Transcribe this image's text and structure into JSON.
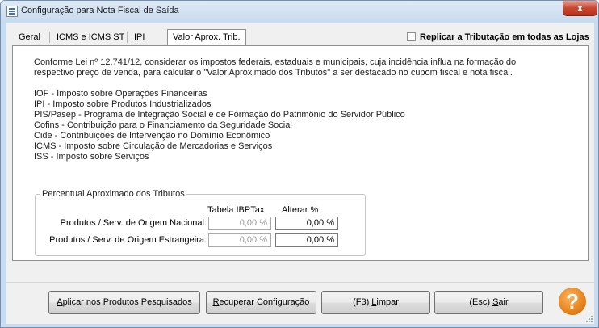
{
  "window": {
    "title": "Configuração para Nota Fiscal de Saída",
    "close_label": "x"
  },
  "tabs": [
    {
      "label": "Geral",
      "active": false
    },
    {
      "label": "ICMS e ICMS ST",
      "active": false
    },
    {
      "label": "IPI",
      "active": false
    },
    {
      "label": "Valor Aprox. Trib.",
      "active": true
    }
  ],
  "replicar": {
    "label": "Replicar a Tributação em todas as Lojas",
    "checked": false
  },
  "panel": {
    "intro_line1": "Conforme Lei nº 12.741/12, considerar os impostos federais, estaduais e municipais, cuja incidência influa na formação do",
    "intro_line2": "respectivo preço de venda, para calcular o \"Valor Aproximado dos Tributos\" a ser destacado no cupom fiscal e nota fiscal.",
    "taxes": [
      "IOF - Imposto sobre Operações Financeiras",
      "IPI - Imposto sobre Produtos Industrializados",
      "PIS/Pasep - Programa de Integração Social e de Formação do Patrimônio do Servidor Público",
      "Cofins - Contribuição para o Financiamento da Seguridade Social",
      "Cide - Contribuições de Intervenção no Domínio Econômico",
      "ICMS - Imposto sobre Circulação de Mercadorias e Serviços",
      "ISS - Imposto sobre Serviços"
    ]
  },
  "percentual": {
    "title": "Percentual Aproximado dos Tributos",
    "col_tabela": "Tabela IBPTax",
    "col_alterar": "Alterar %",
    "rows": [
      {
        "label": "Produtos / Serv. de Origem Nacional:",
        "tabela": "0,00 %",
        "alterar": "0,00 %"
      },
      {
        "label": "Produtos / Serv. de Origem Estrangeira:",
        "tabela": "0,00 %",
        "alterar": "0,00 %"
      }
    ]
  },
  "buttons": {
    "aplicar_u": "A",
    "aplicar_rest": "plicar nos Produtos Pesquisados",
    "recuperar_u": "R",
    "recuperar_rest": "ecuperar Configuração",
    "limpar_pre": "(F3) ",
    "limpar_u": "L",
    "limpar_rest": "impar",
    "sair_pre": "(Esc) ",
    "sair_u": "S",
    "sair_rest": "air"
  },
  "help": {
    "glyph": "?",
    "icon": "help-icon"
  }
}
